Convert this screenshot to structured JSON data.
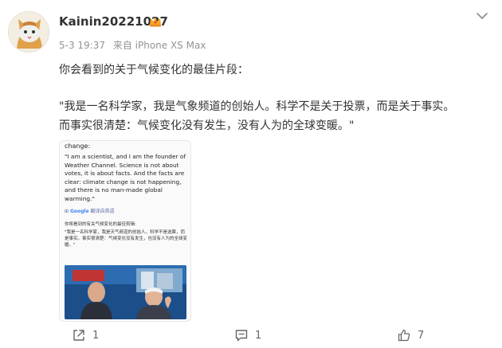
{
  "post": {
    "username": "Kainin20221027",
    "timestamp": "5-3 19:37",
    "source": "来自 iPhone XS Max",
    "text_line1": "你会看到的关于气候变化的最佳片段：",
    "text_line2": "\"我是一名科学家，我是气象频道的创始人。科学不是关于投票，而是关于事实。",
    "text_line3": "而事实很清楚：气候变化没有发生，没有人为的全球变暖。\""
  },
  "embed": {
    "en_head": "change:",
    "en_quote": "\"I am a scientist, and I am the founder of Weather Channel. Science is not about votes, it is about facts. And the facts are clear: climate change is not happening, and there is no man-made global warming.\"",
    "google_label": "Google",
    "translate_label": "翻译自英语",
    "cn_head": "你将看到的有关气候变化的最佳剪辑:",
    "cn_quote": "\"我是一名科学家，我是天气频道的创始人。科学不是选票，而是事实。事实很清楚：气候变化没有发生，也没有人为的全球变暖。\""
  },
  "actions": {
    "share_count": "1",
    "comment_count": "1",
    "like_count": "7"
  },
  "icons": {
    "avatar": "cat-avatar",
    "badge": "crown-icon",
    "more": "chevron-down-icon",
    "share": "share-icon",
    "comment": "comment-icon",
    "like": "thumbs-up-icon"
  },
  "colors": {
    "username": "#333333",
    "meta": "#939393",
    "action": "#666666",
    "badge": "#f6a623"
  }
}
